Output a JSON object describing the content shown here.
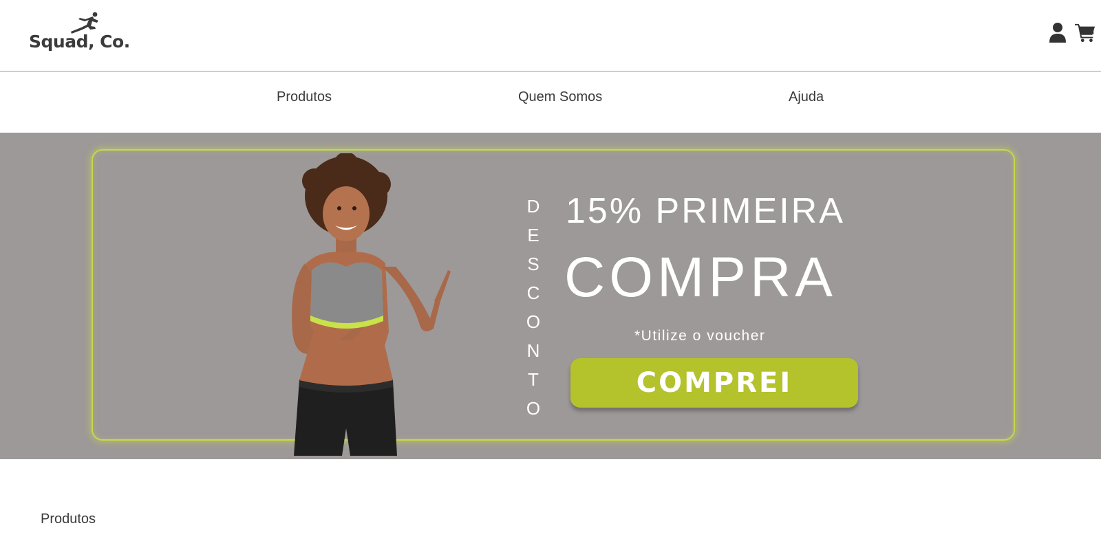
{
  "brand": {
    "name": "Squad, Co."
  },
  "header": {
    "icons": [
      "user-icon",
      "cart-icon"
    ]
  },
  "nav": {
    "items": [
      {
        "label": "Produtos"
      },
      {
        "label": "Quem Somos"
      },
      {
        "label": "Ajuda"
      }
    ]
  },
  "banner": {
    "vertical_word": [
      "D",
      "E",
      "S",
      "C",
      "O",
      "N",
      "T",
      "O"
    ],
    "headline_1": "15% PRIMEIRA",
    "headline_2": "COMPRA",
    "note": "*Utilize o voucher",
    "button_label": "COMPREI",
    "colors": {
      "background": "#9d9998",
      "accent": "#b4c22c",
      "frame_glow": "#c7d84a"
    }
  },
  "main": {
    "section_title": "Produtos"
  }
}
